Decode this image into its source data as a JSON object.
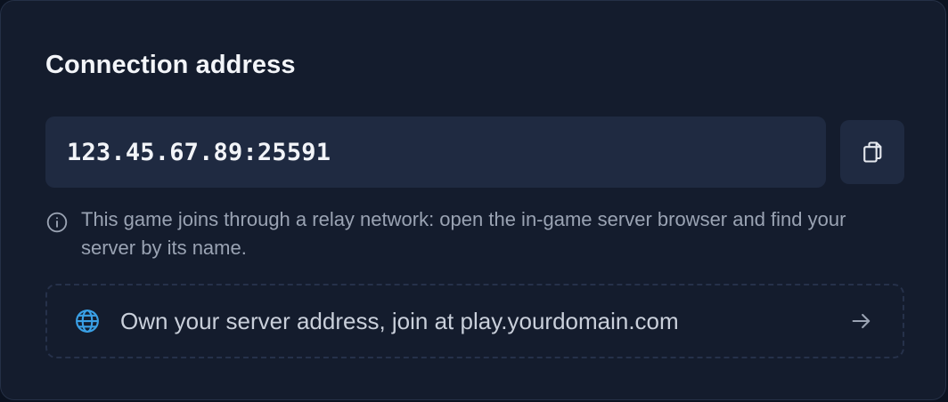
{
  "card": {
    "title": "Connection address"
  },
  "address": {
    "value": "123.45.67.89:25591",
    "copy_icon": "copy-icon"
  },
  "info": {
    "icon": "info-icon",
    "text": "This game joins through a relay network: open the in-game server browser and find your server by its name."
  },
  "promo": {
    "icon": "globe-icon",
    "text": "Own your server address, join at play.yourdomain.com",
    "arrow_icon": "arrow-right-icon"
  },
  "colors": {
    "card_background": "#141c2d",
    "field_background": "#1f2a41",
    "accent_globe": "#3aa0e6",
    "text_primary": "#f3f5f9",
    "text_muted": "#9aa3b3"
  }
}
